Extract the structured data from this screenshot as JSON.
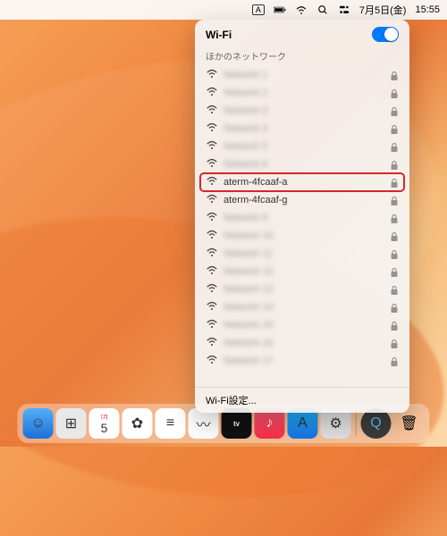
{
  "menubar": {
    "input_indicator": "A",
    "date": "7月5日(金)",
    "time": "15:55"
  },
  "wifi": {
    "title": "Wi-Fi",
    "section_label": "ほかのネットワーク",
    "settings_label": "Wi-Fi設定...",
    "networks": [
      {
        "name": "Network 1",
        "blurred": true,
        "locked": true,
        "highlight": false
      },
      {
        "name": "Network 2",
        "blurred": true,
        "locked": true,
        "highlight": false
      },
      {
        "name": "Network 3",
        "blurred": true,
        "locked": true,
        "highlight": false
      },
      {
        "name": "Network 4",
        "blurred": true,
        "locked": true,
        "highlight": false
      },
      {
        "name": "Network 5",
        "blurred": true,
        "locked": true,
        "highlight": false
      },
      {
        "name": "Network 6",
        "blurred": true,
        "locked": true,
        "highlight": false
      },
      {
        "name": "aterm-4fcaaf-a",
        "blurred": false,
        "locked": true,
        "highlight": true
      },
      {
        "name": "aterm-4fcaaf-g",
        "blurred": false,
        "locked": true,
        "highlight": false
      },
      {
        "name": "Network 9",
        "blurred": true,
        "locked": true,
        "highlight": false
      },
      {
        "name": "Network 10",
        "blurred": true,
        "locked": true,
        "highlight": false
      },
      {
        "name": "Network 11",
        "blurred": true,
        "locked": true,
        "highlight": false
      },
      {
        "name": "Network 12",
        "blurred": true,
        "locked": true,
        "highlight": false
      },
      {
        "name": "Network 13",
        "blurred": true,
        "locked": true,
        "highlight": false
      },
      {
        "name": "Network 14",
        "blurred": true,
        "locked": true,
        "highlight": false
      },
      {
        "name": "Network 15",
        "blurred": true,
        "locked": true,
        "highlight": false
      },
      {
        "name": "Network 16",
        "blurred": true,
        "locked": true,
        "highlight": false
      },
      {
        "name": "Network 17",
        "blurred": true,
        "locked": true,
        "highlight": false
      }
    ]
  },
  "dock": {
    "apps": [
      {
        "name": "finder",
        "bg": "linear-gradient(#4fb0f7,#1e6fd9)"
      },
      {
        "name": "launchpad",
        "bg": "#e8e8e8"
      },
      {
        "name": "calendar",
        "bg": "#fff"
      },
      {
        "name": "photos",
        "bg": "#fff"
      },
      {
        "name": "reminders",
        "bg": "#fff"
      },
      {
        "name": "freeform",
        "bg": "#fff"
      },
      {
        "name": "tv",
        "bg": "#111"
      },
      {
        "name": "music",
        "bg": "linear-gradient(#fb5b74,#fa2d48)"
      },
      {
        "name": "appstore",
        "bg": "linear-gradient(#1fb4f7,#1971e6)"
      },
      {
        "name": "settings",
        "bg": "#e0e0e0"
      }
    ],
    "right": [
      {
        "name": "quicktime",
        "bg": "#3b3b3b"
      },
      {
        "name": "trash",
        "bg": "transparent"
      }
    ]
  }
}
